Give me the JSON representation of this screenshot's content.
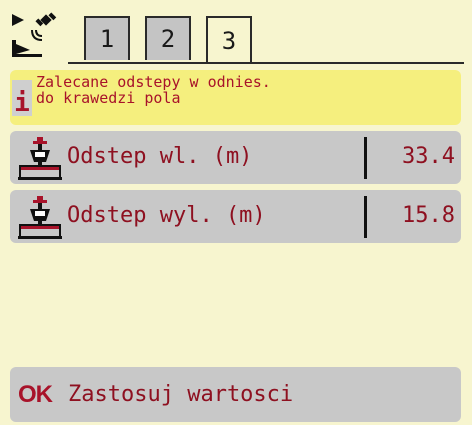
{
  "tabs": [
    {
      "label": "1",
      "active": false
    },
    {
      "label": "2",
      "active": false
    },
    {
      "label": "3",
      "active": true
    }
  ],
  "info": {
    "icon": "info-icon",
    "icon_glyph": "i",
    "text": "Zalecane odstepy w odnies.\ndo krawedzi pola"
  },
  "rows": [
    {
      "label": "Odstep wl. (m)",
      "value": "33.4",
      "icon": "spreader-distance-icon"
    },
    {
      "label": "Odstep wyl. (m)",
      "value": "15.8",
      "icon": "spreader-offset-icon"
    }
  ],
  "apply": {
    "badge": "OK",
    "label": "Zastosuj wartosci"
  },
  "colors": {
    "background": "#f7f5cf",
    "info_bg": "#f5ef7e",
    "accent": "#a8132a",
    "row_bg": "#c8c8c8"
  }
}
